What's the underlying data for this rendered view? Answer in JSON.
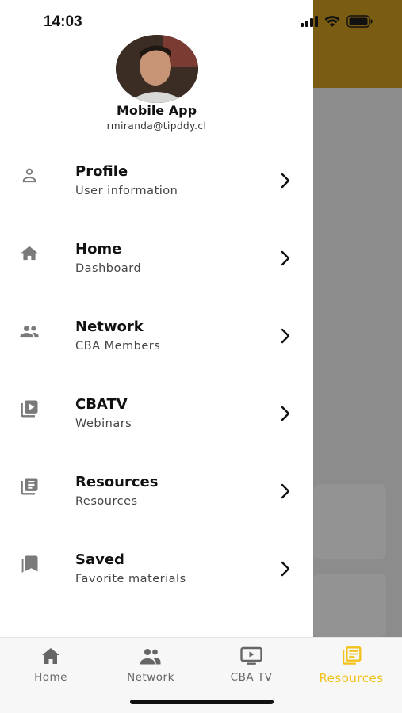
{
  "status_bar": {
    "time": "14:03"
  },
  "drawer": {
    "user": {
      "name": "Mobile App",
      "email": "rmiranda@tipddy.cl"
    },
    "items": [
      {
        "title": "Profile",
        "subtitle": "User information",
        "icon": "person-icon"
      },
      {
        "title": "Home",
        "subtitle": "Dashboard",
        "icon": "home-icon"
      },
      {
        "title": "Network",
        "subtitle": "CBA Members",
        "icon": "people-icon"
      },
      {
        "title": "CBATV",
        "subtitle": "Webinars",
        "icon": "video-library-icon"
      },
      {
        "title": "Resources",
        "subtitle": "Resources",
        "icon": "documents-icon"
      },
      {
        "title": "Saved",
        "subtitle": "Favorite materials",
        "icon": "bookmarks-icon"
      }
    ]
  },
  "tabbar": {
    "tabs": [
      {
        "label": "Home",
        "icon": "home-icon",
        "active": false
      },
      {
        "label": "Network",
        "icon": "people-icon",
        "active": false
      },
      {
        "label": "CBA TV",
        "icon": "tv-icon",
        "active": false
      },
      {
        "label": "Resources",
        "icon": "documents-icon",
        "active": true
      }
    ]
  },
  "colors": {
    "accent": "#f2c21a",
    "header_bg": "#7a5d12",
    "overlay": "#8c8c8c"
  }
}
